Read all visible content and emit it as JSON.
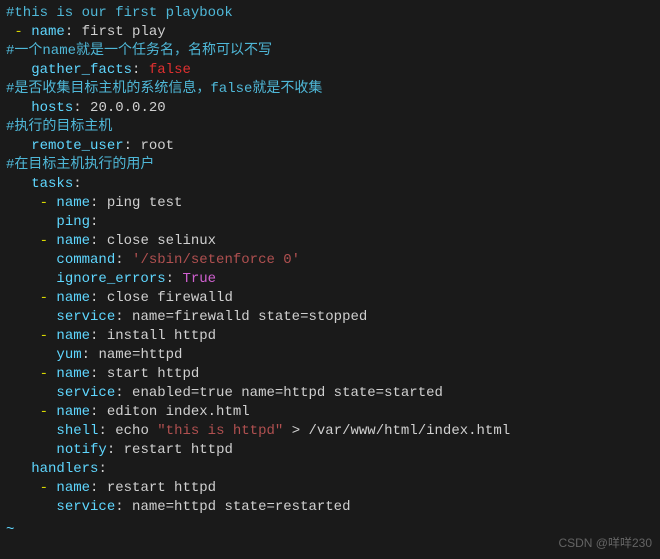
{
  "watermark": "CSDN @咩咩230",
  "tilde": "~",
  "lines": [
    [
      {
        "t": "#this is our first playbook",
        "c": "c-comment"
      }
    ],
    [
      {
        "t": " ",
        "c": "c-str"
      },
      {
        "t": "-",
        "c": "c-dash"
      },
      {
        "t": " ",
        "c": "c-str"
      },
      {
        "t": "name",
        "c": "c-key"
      },
      {
        "t": ":",
        "c": "c-col"
      },
      {
        "t": " first play",
        "c": "c-str"
      }
    ],
    [
      {
        "t": "#一个name就是一个任务名，名称可以不写",
        "c": "c-comment"
      }
    ],
    [
      {
        "t": "   ",
        "c": "c-str"
      },
      {
        "t": "gather_facts",
        "c": "c-key"
      },
      {
        "t": ":",
        "c": "c-col"
      },
      {
        "t": " ",
        "c": "c-str"
      },
      {
        "t": "false",
        "c": "c-false"
      }
    ],
    [
      {
        "t": "#是否收集目标主机的系统信息，false就是不收集",
        "c": "c-comment"
      }
    ],
    [
      {
        "t": "   ",
        "c": "c-str"
      },
      {
        "t": "hosts",
        "c": "c-key"
      },
      {
        "t": ":",
        "c": "c-col"
      },
      {
        "t": " 20.0.0.20",
        "c": "c-num"
      }
    ],
    [
      {
        "t": "#执行的目标主机",
        "c": "c-comment"
      }
    ],
    [
      {
        "t": "   ",
        "c": "c-str"
      },
      {
        "t": "remote_user",
        "c": "c-key"
      },
      {
        "t": ":",
        "c": "c-col"
      },
      {
        "t": " root",
        "c": "c-str"
      }
    ],
    [
      {
        "t": "#在目标主机执行的用户",
        "c": "c-comment"
      }
    ],
    [
      {
        "t": "   ",
        "c": "c-str"
      },
      {
        "t": "tasks",
        "c": "c-key"
      },
      {
        "t": ":",
        "c": "c-col"
      }
    ],
    [
      {
        "t": "    ",
        "c": "c-str"
      },
      {
        "t": "-",
        "c": "c-dash"
      },
      {
        "t": " ",
        "c": "c-str"
      },
      {
        "t": "name",
        "c": "c-key"
      },
      {
        "t": ":",
        "c": "c-col"
      },
      {
        "t": " ping test",
        "c": "c-str"
      }
    ],
    [
      {
        "t": "      ",
        "c": "c-str"
      },
      {
        "t": "ping",
        "c": "c-key"
      },
      {
        "t": ":",
        "c": "c-col"
      }
    ],
    [
      {
        "t": "    ",
        "c": "c-str"
      },
      {
        "t": "-",
        "c": "c-dash"
      },
      {
        "t": " ",
        "c": "c-str"
      },
      {
        "t": "name",
        "c": "c-key"
      },
      {
        "t": ":",
        "c": "c-col"
      },
      {
        "t": " close selinux",
        "c": "c-str"
      }
    ],
    [
      {
        "t": "      ",
        "c": "c-str"
      },
      {
        "t": "command",
        "c": "c-key"
      },
      {
        "t": ":",
        "c": "c-col"
      },
      {
        "t": " ",
        "c": "c-str"
      },
      {
        "t": "'/sbin/setenforce 0'",
        "c": "c-quoted"
      }
    ],
    [
      {
        "t": "      ",
        "c": "c-str"
      },
      {
        "t": "ignore_errors",
        "c": "c-key"
      },
      {
        "t": ":",
        "c": "c-col"
      },
      {
        "t": " ",
        "c": "c-str"
      },
      {
        "t": "True",
        "c": "c-true"
      }
    ],
    [
      {
        "t": "    ",
        "c": "c-str"
      },
      {
        "t": "-",
        "c": "c-dash"
      },
      {
        "t": " ",
        "c": "c-str"
      },
      {
        "t": "name",
        "c": "c-key"
      },
      {
        "t": ":",
        "c": "c-col"
      },
      {
        "t": " close firewalld",
        "c": "c-str"
      }
    ],
    [
      {
        "t": "      ",
        "c": "c-str"
      },
      {
        "t": "service",
        "c": "c-key"
      },
      {
        "t": ":",
        "c": "c-col"
      },
      {
        "t": " name=firewalld state=stopped",
        "c": "c-str"
      }
    ],
    [
      {
        "t": "    ",
        "c": "c-str"
      },
      {
        "t": "-",
        "c": "c-dash"
      },
      {
        "t": " ",
        "c": "c-str"
      },
      {
        "t": "name",
        "c": "c-key"
      },
      {
        "t": ":",
        "c": "c-col"
      },
      {
        "t": " install httpd",
        "c": "c-str"
      }
    ],
    [
      {
        "t": "      ",
        "c": "c-str"
      },
      {
        "t": "yum",
        "c": "c-key"
      },
      {
        "t": ":",
        "c": "c-col"
      },
      {
        "t": " name=httpd",
        "c": "c-str"
      }
    ],
    [
      {
        "t": "    ",
        "c": "c-str"
      },
      {
        "t": "-",
        "c": "c-dash"
      },
      {
        "t": " ",
        "c": "c-str"
      },
      {
        "t": "name",
        "c": "c-key"
      },
      {
        "t": ":",
        "c": "c-col"
      },
      {
        "t": " start httpd",
        "c": "c-str"
      }
    ],
    [
      {
        "t": "      ",
        "c": "c-str"
      },
      {
        "t": "service",
        "c": "c-key"
      },
      {
        "t": ":",
        "c": "c-col"
      },
      {
        "t": " enabled=true name=httpd state=started",
        "c": "c-str"
      }
    ],
    [
      {
        "t": "    ",
        "c": "c-str"
      },
      {
        "t": "-",
        "c": "c-dash"
      },
      {
        "t": " ",
        "c": "c-str"
      },
      {
        "t": "name",
        "c": "c-key"
      },
      {
        "t": ":",
        "c": "c-col"
      },
      {
        "t": " editon index.html",
        "c": "c-str"
      }
    ],
    [
      {
        "t": "      ",
        "c": "c-str"
      },
      {
        "t": "shell",
        "c": "c-key"
      },
      {
        "t": ":",
        "c": "c-col"
      },
      {
        "t": " echo ",
        "c": "c-str"
      },
      {
        "t": "\"this is httpd\"",
        "c": "c-quoted"
      },
      {
        "t": " > /var/www/html/index.html",
        "c": "c-str"
      }
    ],
    [
      {
        "t": "      ",
        "c": "c-str"
      },
      {
        "t": "notify",
        "c": "c-key"
      },
      {
        "t": ":",
        "c": "c-col"
      },
      {
        "t": " restart httpd",
        "c": "c-str"
      }
    ],
    [
      {
        "t": "   ",
        "c": "c-str"
      },
      {
        "t": "handlers",
        "c": "c-key"
      },
      {
        "t": ":",
        "c": "c-col"
      }
    ],
    [
      {
        "t": "    ",
        "c": "c-str"
      },
      {
        "t": "-",
        "c": "c-dash"
      },
      {
        "t": " ",
        "c": "c-str"
      },
      {
        "t": "name",
        "c": "c-key"
      },
      {
        "t": ":",
        "c": "c-col"
      },
      {
        "t": " restart httpd",
        "c": "c-str"
      }
    ],
    [
      {
        "t": "      ",
        "c": "c-str"
      },
      {
        "t": "service",
        "c": "c-key"
      },
      {
        "t": ":",
        "c": "c-col"
      },
      {
        "t": " name=httpd state=restarted",
        "c": "c-str"
      }
    ]
  ]
}
